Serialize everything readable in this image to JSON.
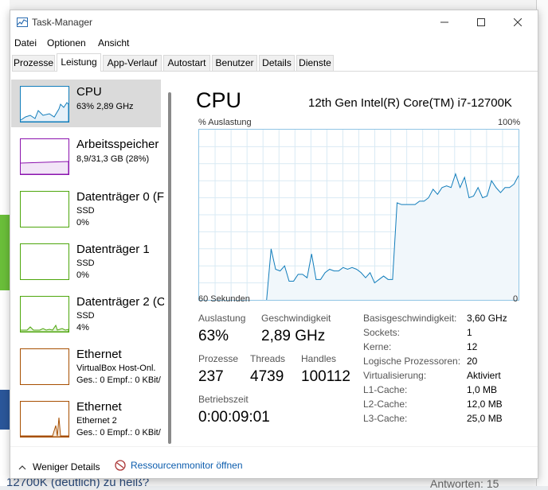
{
  "window": {
    "title": "Task-Manager"
  },
  "menu": [
    "Datei",
    "Optionen",
    "Ansicht"
  ],
  "tabs": [
    "Prozesse",
    "Leistung",
    "App-Verlauf",
    "Autostart",
    "Benutzer",
    "Details",
    "Dienste"
  ],
  "active_tab": "Leistung",
  "sidebar": {
    "items": [
      {
        "name": "CPU",
        "line1": "63% 2,89 GHz",
        "line2": "",
        "color": "#117dbb"
      },
      {
        "name": "Arbeitsspeicher",
        "line1": "8,9/31,3 GB (28%)",
        "line2": "",
        "color": "#8b12ae"
      },
      {
        "name": "Datenträger 0 (F",
        "line1": "SSD",
        "line2": "0%",
        "color": "#4da60c"
      },
      {
        "name": "Datenträger 1",
        "line1": "SSD",
        "line2": "0%",
        "color": "#4da60c"
      },
      {
        "name": "Datenträger 2 (C",
        "line1": "SSD",
        "line2": "4%",
        "color": "#4da60c"
      },
      {
        "name": "Ethernet",
        "line1": "VirtualBox Host-Onl.",
        "line2": "Ges.: 0 Empf.: 0 KBit/",
        "color": "#a74f01"
      },
      {
        "name": "Ethernet",
        "line1": "Ethernet 2",
        "line2": "Ges.: 0 Empf.: 0 KBit/",
        "color": "#a74f01"
      }
    ]
  },
  "main": {
    "title": "CPU",
    "model": "12th Gen Intel(R) Core(TM) i7-12700K",
    "graph_label": "% Auslastung",
    "graph_max": "100%",
    "graph_time": "60 Sekunden",
    "graph_min": "0",
    "stats": {
      "usage_label": "Auslastung",
      "usage_value": "63%",
      "speed_label": "Geschwindigkeit",
      "speed_value": "2,89 GHz",
      "processes_label": "Prozesse",
      "processes_value": "237",
      "threads_label": "Threads",
      "threads_value": "4739",
      "handles_label": "Handles",
      "handles_value": "100112",
      "uptime_label": "Betriebszeit",
      "uptime_value": "0:00:09:01"
    },
    "info": [
      {
        "label": "Basisgeschwindigkeit:",
        "value": "3,60 GHz"
      },
      {
        "label": "Sockets:",
        "value": "1"
      },
      {
        "label": "Kerne:",
        "value": "12"
      },
      {
        "label": "Logische Prozessoren:",
        "value": "20"
      },
      {
        "label": "Virtualisierung:",
        "value": "Aktiviert"
      },
      {
        "label": "L1-Cache:",
        "value": "1,0 MB"
      },
      {
        "label": "L2-Cache:",
        "value": "12,0 MB"
      },
      {
        "label": "L3-Cache:",
        "value": "25,0 MB"
      }
    ]
  },
  "footer": {
    "less_details": "Weniger Details",
    "resmon": "Ressourcenmonitor öffnen"
  },
  "background": {
    "bottom_text": "12700K (deutlich) zu heiß?",
    "bottom_right": "Antworten:   15"
  },
  "chart_data": {
    "type": "area",
    "ylabel": "% Auslastung",
    "ylim": [
      0,
      100
    ],
    "x": [
      0,
      1,
      2,
      3,
      4,
      5,
      6,
      7,
      8,
      9,
      10,
      11,
      12,
      13,
      14,
      15,
      16,
      17,
      18,
      19,
      20,
      21,
      22,
      23,
      24,
      25,
      26,
      27,
      28,
      29,
      30,
      31,
      32,
      33,
      34,
      35,
      36,
      37,
      38,
      39,
      40,
      41,
      42,
      43,
      44,
      45,
      46,
      47,
      48,
      49,
      50,
      51,
      52,
      53,
      54,
      55,
      56,
      57,
      58,
      59,
      60
    ],
    "series": [
      {
        "values": [
          0,
          0,
          0,
          0,
          0,
          0,
          0,
          0,
          0,
          0,
          0,
          0,
          0,
          0,
          0,
          0,
          30,
          18,
          17,
          20,
          11,
          11,
          15,
          15,
          13,
          27,
          12,
          12,
          16,
          18,
          17,
          17,
          19,
          18,
          19,
          18,
          16,
          13,
          16,
          10,
          12,
          14,
          12,
          12,
          57,
          56,
          56,
          56,
          56,
          58,
          58,
          60,
          65,
          62,
          66,
          67,
          66,
          74,
          66,
          72,
          60,
          61,
          66,
          60,
          61,
          70,
          66,
          63,
          66,
          66,
          68,
          73
        ]
      }
    ]
  }
}
